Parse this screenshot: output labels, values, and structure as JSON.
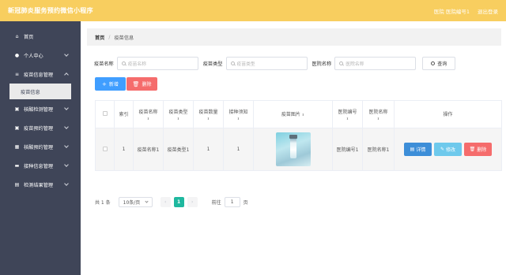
{
  "header": {
    "title": "新冠肺炎服务预约微信小程序",
    "hospital_info": "医院 医院编号1",
    "logout": "退出登录"
  },
  "sidebar": {
    "items": [
      {
        "label": "首页",
        "icon": "home-icon"
      },
      {
        "label": "个人中心",
        "icon": "user-icon"
      },
      {
        "label": "疫苗信息管理",
        "icon": "list-icon",
        "sub": "疫苗信息"
      },
      {
        "label": "核酸检测管理",
        "icon": "briefcase-icon"
      },
      {
        "label": "疫苗预约管理",
        "icon": "briefcase-icon"
      },
      {
        "label": "核酸预约管理",
        "icon": "grid-icon"
      },
      {
        "label": "接种信息管理",
        "icon": "card-icon"
      },
      {
        "label": "检测结果管理",
        "icon": "book-icon"
      }
    ]
  },
  "breadcrumb": {
    "home": "首页",
    "current": "疫苗信息"
  },
  "search": {
    "vaccine_name_label": "疫苗名称",
    "vaccine_name_placeholder": "疫苗名称",
    "vaccine_type_label": "疫苗类型",
    "vaccine_type_placeholder": "疫苗类型",
    "hospital_name_label": "医院名称",
    "hospital_name_placeholder": "医院名称",
    "query_label": "查询"
  },
  "actions": {
    "add_label": "新增",
    "delete_label": "删除"
  },
  "table": {
    "headers": [
      "索引",
      "疫苗名称",
      "疫苗类型",
      "疫苗数量",
      "接种须知",
      "疫苗图片",
      "医院编号",
      "医院名称",
      "操作"
    ],
    "rows": [
      {
        "index": "1",
        "name": "疫苗名称1",
        "type": "疫苗类型1",
        "count": "1",
        "notice": "1",
        "hospital_no": "医院编号1",
        "hospital_name": "医院名称1"
      }
    ],
    "op_labels": {
      "detail": "详情",
      "edit": "修改",
      "delete": "删除"
    }
  },
  "pagination": {
    "total": "共 1 条",
    "page_size": "10条/页",
    "current_page": "1",
    "goto_label": "前往",
    "goto_value": "1",
    "goto_unit": "页"
  },
  "colors": {
    "header": "#f8ce5f",
    "sidebar": "#3f4558",
    "primary": "#409eff",
    "danger": "#f56c6c",
    "active_page": "#1fb89f"
  }
}
